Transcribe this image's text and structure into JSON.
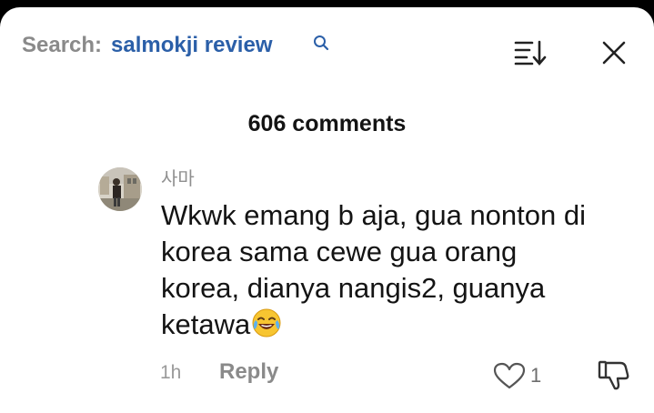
{
  "search": {
    "label": "Search:",
    "term": "salmokji review"
  },
  "comments_count": "606 comments",
  "comment": {
    "username": "사마",
    "text": "Wkwk emang b aja, gua nonton di korea sama cewe gua orang korea, dianya nangis2, guanya ketawa",
    "emoji": "face-with-tears-of-joy-icon",
    "time": "1h",
    "reply_label": "Reply",
    "likes": "1"
  },
  "icons": [
    "search-icon",
    "sort-icon",
    "close-icon",
    "heart-icon",
    "thumbs-down-icon"
  ]
}
